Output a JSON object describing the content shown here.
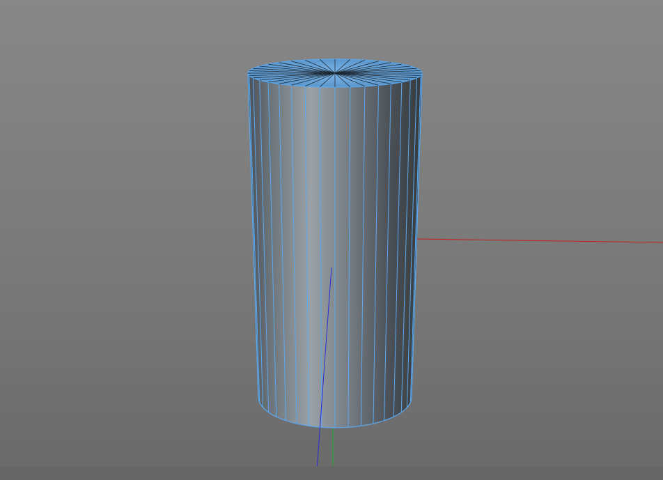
{
  "viewport": {
    "background_top": "#878787",
    "background_bottom": "#6a6a6a"
  },
  "object": {
    "type": "cylinder",
    "rotation_segments": 36,
    "selected": true,
    "selection_color": "#5aa9f0",
    "body_color_dark": "#404549",
    "body_color_light": "#8f969c"
  },
  "axes": {
    "x_axis_color": "#c81e1e",
    "y_axis_color": "#1fae2a",
    "z_axis_color": "#2a2ad8"
  }
}
